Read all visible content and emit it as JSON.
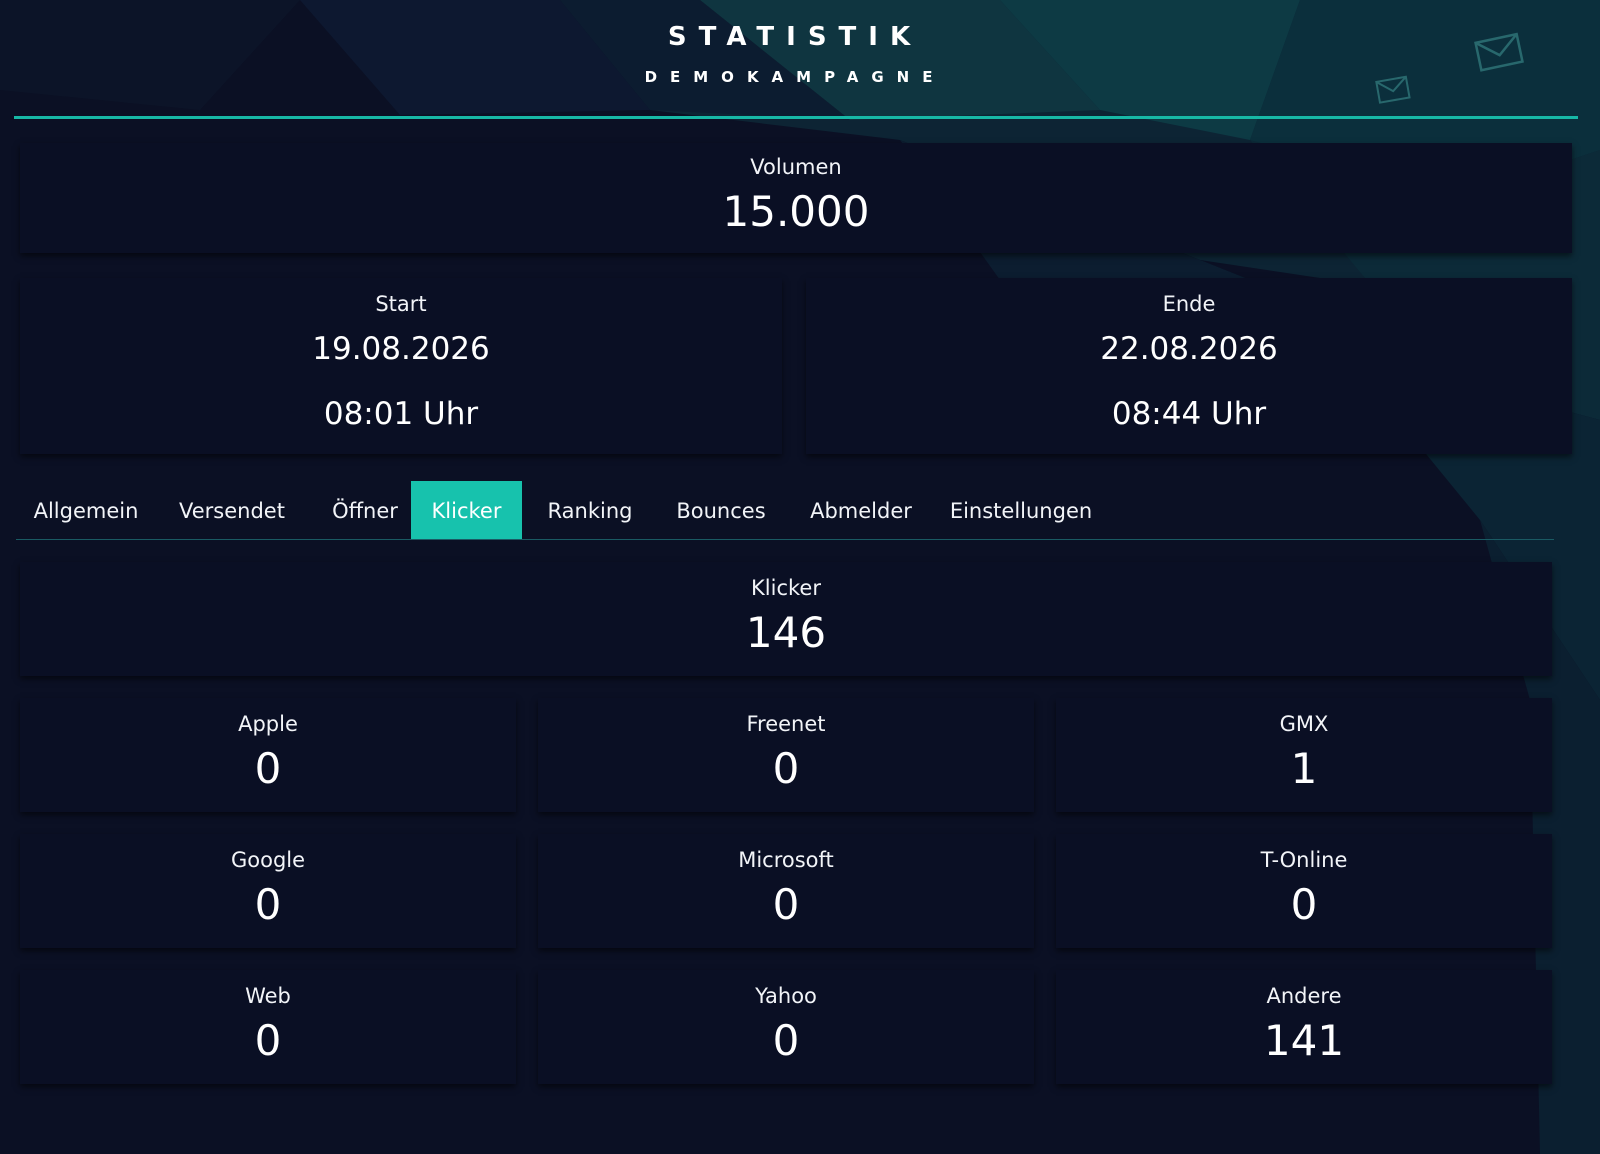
{
  "header": {
    "title": "STATISTIK",
    "subtitle": "DEMOKAMPAGNE"
  },
  "icons": {
    "decor": "envelope-icon"
  },
  "colors": {
    "background": "#0b1024",
    "card": "#0a0f24",
    "accent": "#17c2ad"
  },
  "volume": {
    "label": "Volumen",
    "value": "15.000"
  },
  "start": {
    "label": "Start",
    "date": "19.08.2026",
    "time": "08:01 Uhr"
  },
  "end": {
    "label": "Ende",
    "date": "22.08.2026",
    "time": "08:44 Uhr"
  },
  "tabs": [
    {
      "label": "Allgemein",
      "active": false
    },
    {
      "label": "Versendet",
      "active": false
    },
    {
      "label": "Öffner",
      "active": false
    },
    {
      "label": "Klicker",
      "active": true
    },
    {
      "label": "Ranking",
      "active": false
    },
    {
      "label": "Bounces",
      "active": false
    },
    {
      "label": "Abmelder",
      "active": false
    },
    {
      "label": "Einstellungen",
      "active": false
    }
  ],
  "clicker_total": {
    "label": "Klicker",
    "value": "146"
  },
  "providers": [
    {
      "label": "Apple",
      "value": "0"
    },
    {
      "label": "Freenet",
      "value": "0"
    },
    {
      "label": "GMX",
      "value": "1"
    },
    {
      "label": "Google",
      "value": "0"
    },
    {
      "label": "Microsoft",
      "value": "0"
    },
    {
      "label": "T-Online",
      "value": "0"
    },
    {
      "label": "Web",
      "value": "0"
    },
    {
      "label": "Yahoo",
      "value": "0"
    },
    {
      "label": "Andere",
      "value": "141"
    }
  ]
}
